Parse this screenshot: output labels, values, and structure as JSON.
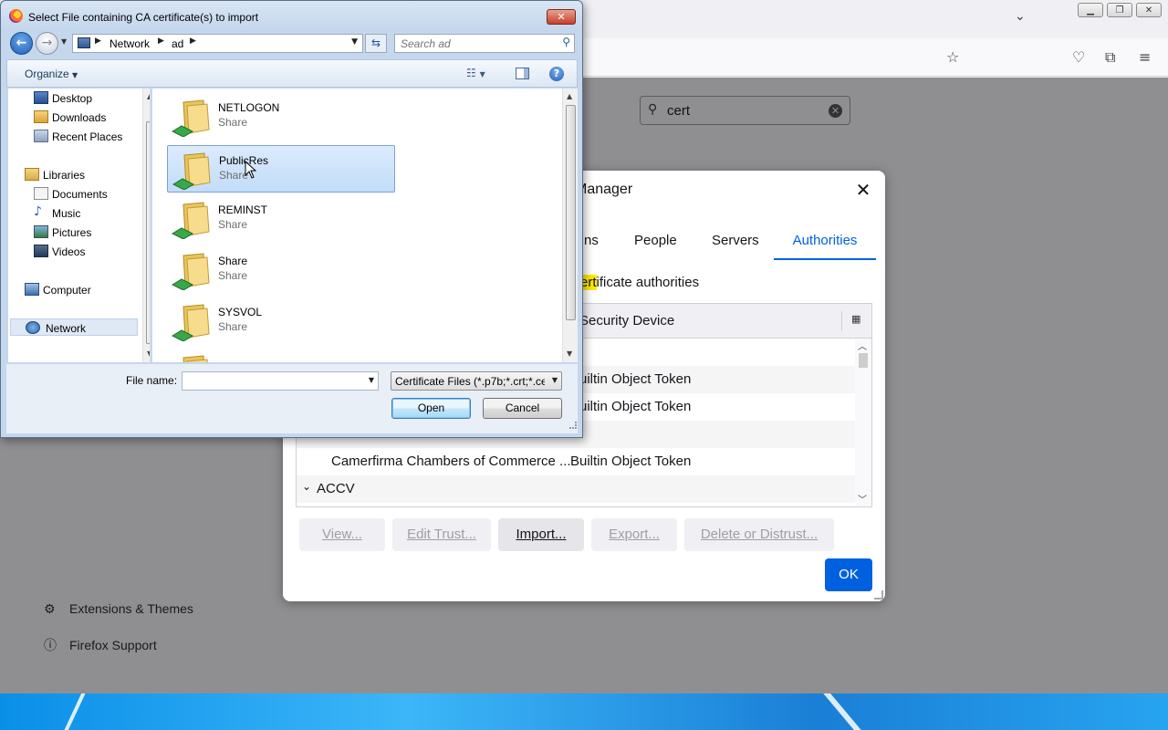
{
  "firefox": {
    "search_value": "cert",
    "footer_links": [
      "Extensions & Themes",
      "Firefox Support"
    ]
  },
  "cert_manager": {
    "title_fragment": "Manager",
    "tabs": [
      {
        "label": "ns",
        "active": false
      },
      {
        "label": "People",
        "active": false
      },
      {
        "label": "Servers",
        "active": false
      },
      {
        "label": "Authorities",
        "active": true
      }
    ],
    "description_highlight": "ert",
    "description_rest": "ificate authorities",
    "column_header_fragment": "Security Device",
    "rows": [
      {
        "name": "",
        "device": "Builtin Object Token"
      },
      {
        "name": "",
        "device": "Builtin Object Token"
      },
      {
        "name": "Camerfirma Chambers of Commerce ...",
        "device": "Builtin Object Token"
      }
    ],
    "group_label": "ACCV",
    "buttons": [
      "View...",
      "Edit Trust...",
      "Import...",
      "Export...",
      "Delete or Distrust..."
    ],
    "ok_label": "OK"
  },
  "file_dialog": {
    "title": "Select File containing CA certificate(s) to import",
    "breadcrumb": [
      "Network",
      "ad"
    ],
    "search_placeholder": "Search ad",
    "organize_label": "Organize",
    "nav_items": [
      {
        "label": "Desktop",
        "icon": "desktop-icon"
      },
      {
        "label": "Downloads",
        "icon": "downloads-icon"
      },
      {
        "label": "Recent Places",
        "icon": "recent-places-icon"
      },
      {
        "label": "Libraries",
        "icon": "libraries-icon"
      },
      {
        "label": "Documents",
        "icon": "documents-icon"
      },
      {
        "label": "Music",
        "icon": "music-icon"
      },
      {
        "label": "Pictures",
        "icon": "pictures-icon"
      },
      {
        "label": "Videos",
        "icon": "videos-icon"
      },
      {
        "label": "Computer",
        "icon": "computer-icon"
      },
      {
        "label": "Network",
        "icon": "network-icon"
      }
    ],
    "files": [
      {
        "name": "NETLOGON",
        "type": "Share"
      },
      {
        "name": "PublicRes",
        "type": "Share"
      },
      {
        "name": "REMINST",
        "type": "Share"
      },
      {
        "name": "Share",
        "type": "Share"
      },
      {
        "name": "SYSVOL",
        "type": "Share"
      }
    ],
    "filename_label": "File name:",
    "filename_value": "",
    "filetype_value": "Certificate Files (*.p7b;*.crt;*.ce",
    "open_label": "Open",
    "cancel_label": "Cancel"
  }
}
